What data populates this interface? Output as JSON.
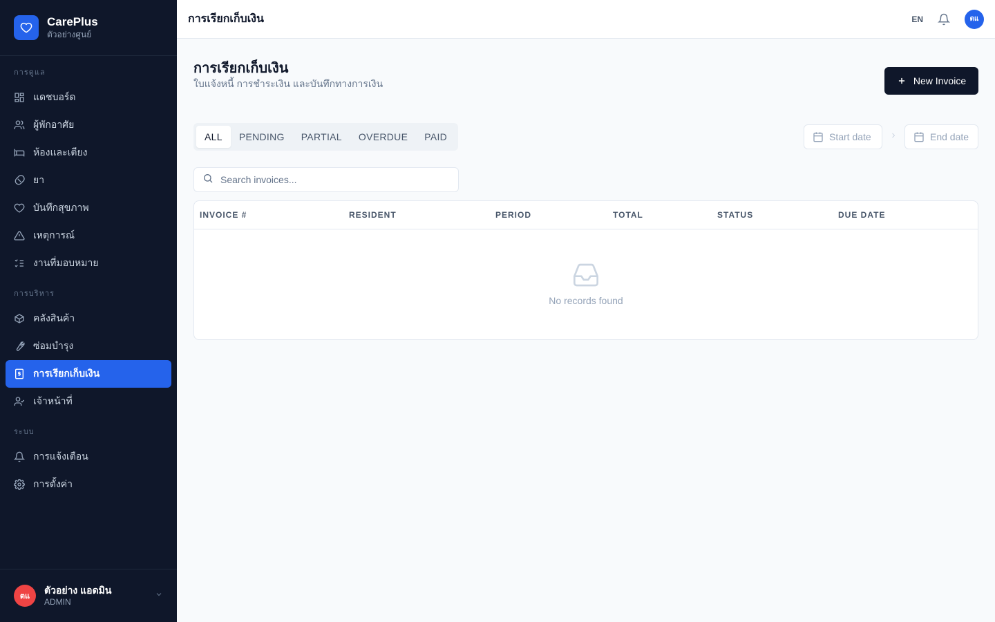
{
  "brand": {
    "name": "CarePlus",
    "subtitle": "ตัวอย่างศูนย์"
  },
  "sidebar": {
    "sections": [
      {
        "label": "การดูแล",
        "items": [
          {
            "label": "แดชบอร์ด",
            "icon": "dashboard-icon"
          },
          {
            "label": "ผู้พักอาศัย",
            "icon": "users-icon"
          },
          {
            "label": "ห้องและเตียง",
            "icon": "bed-icon"
          },
          {
            "label": "ยา",
            "icon": "pill-icon"
          },
          {
            "label": "บันทึกสุขภาพ",
            "icon": "heart-icon"
          },
          {
            "label": "เหตุการณ์",
            "icon": "alert-triangle-icon"
          },
          {
            "label": "งานที่มอบหมาย",
            "icon": "task-list-icon"
          }
        ]
      },
      {
        "label": "การบริหาร",
        "items": [
          {
            "label": "คลังสินค้า",
            "icon": "package-icon"
          },
          {
            "label": "ซ่อมบำรุง",
            "icon": "wrench-icon"
          },
          {
            "label": "การเรียกเก็บเงิน",
            "icon": "receipt-icon",
            "active": true
          },
          {
            "label": "เจ้าหน้าที่",
            "icon": "user-check-icon"
          }
        ]
      },
      {
        "label": "ระบบ",
        "items": [
          {
            "label": "การแจ้งเตือน",
            "icon": "bell-icon"
          },
          {
            "label": "การตั้งค่า",
            "icon": "gear-icon"
          }
        ]
      }
    ]
  },
  "user": {
    "initials": "ตแ",
    "name": "ตัวอย่าง แอดมิน",
    "role": "ADMIN"
  },
  "topbar": {
    "title": "การเรียกเก็บเงิน",
    "lang": "EN",
    "avatar_initials": "ตแ"
  },
  "page": {
    "title": "การเรียกเก็บเงิน",
    "subtitle": "ใบแจ้งหนี้ การชำระเงิน และบันทึกทางการเงิน",
    "new_button": "New Invoice"
  },
  "filters": {
    "tabs": [
      "ALL",
      "PENDING",
      "PARTIAL",
      "OVERDUE",
      "PAID"
    ],
    "active_tab": "ALL",
    "start_date": "Start date",
    "end_date": "End date"
  },
  "search": {
    "placeholder": "Search invoices..."
  },
  "table": {
    "columns": [
      "INVOICE #",
      "RESIDENT",
      "PERIOD",
      "TOTAL",
      "STATUS",
      "DUE DATE"
    ],
    "rows": [],
    "empty_text": "No records found"
  },
  "colors": {
    "sidebar_bg": "#0f172a",
    "accent": "#2563eb",
    "user_avatar": "#ef4444",
    "primary_button": "#0f172a"
  }
}
